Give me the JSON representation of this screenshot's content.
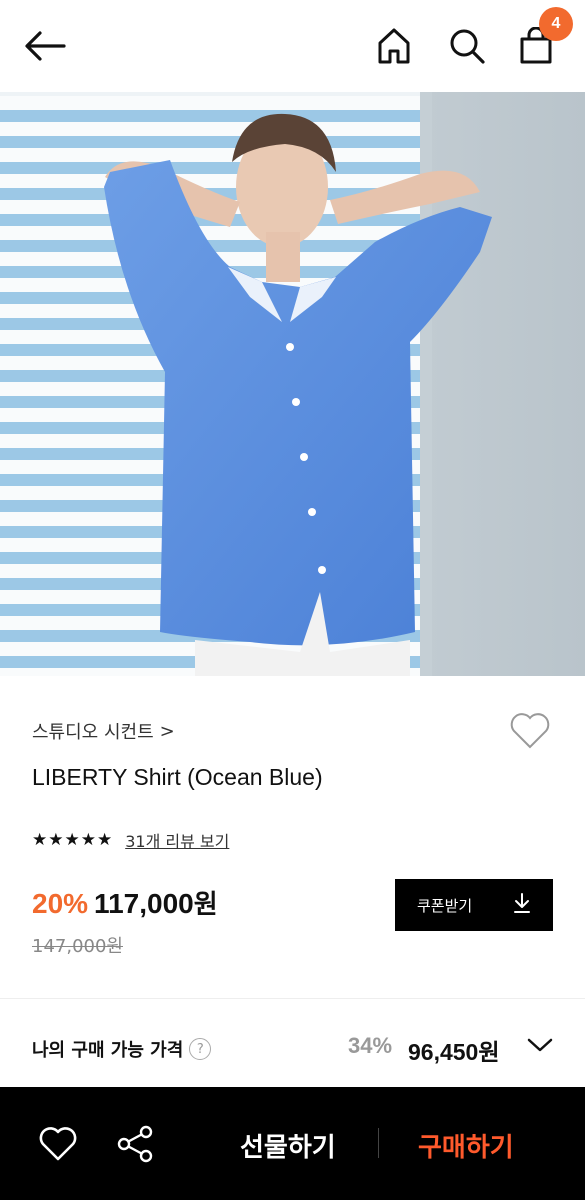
{
  "header": {
    "back_icon": "arrow-left-icon",
    "home_icon": "home-icon",
    "search_icon": "search-icon",
    "cart_icon": "shopping-bag-icon",
    "cart_count": "4"
  },
  "product": {
    "image_icon": "product-photo",
    "brand": "스튜디오 시컨트",
    "brand_chevron": ">",
    "title": "LIBERTY Shirt (Ocean Blue)",
    "stars": "★★★★★",
    "review_link": "31개 리뷰 보기",
    "discount": "20%",
    "price": "117,000",
    "price_unit": "원",
    "original_price": "147,000원",
    "coupon_label": "쿠폰받기",
    "wishlist_icon": "heart-outline-icon"
  },
  "my_price": {
    "label": "나의 구매 가능 가격",
    "help": "?",
    "percent": "34%",
    "price": "96,450원",
    "expand_icon": "chevron-down-icon"
  },
  "bottom_bar": {
    "gift_label": "선물하기",
    "buy_label": "구매하기",
    "heart_icon": "heart-icon",
    "share_icon": "share-icon"
  },
  "colors": {
    "accent": "#f26a2e",
    "buy": "#ff5a2c",
    "bar": "#000000"
  }
}
